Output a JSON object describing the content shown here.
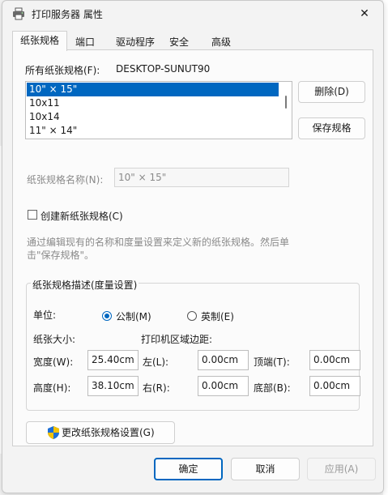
{
  "window": {
    "title": "打印服务器 属性",
    "close_glyph": "✕"
  },
  "tabs": [
    {
      "label": "纸张规格",
      "active": true
    },
    {
      "label": "端口"
    },
    {
      "label": "驱动程序"
    },
    {
      "label": "安全"
    },
    {
      "label": "高级"
    }
  ],
  "forms": {
    "all_forms_label": "所有纸张规格(F):",
    "server_name": "DESKTOP-SUNUT90",
    "list_items": [
      "10\" × 15\"",
      "10x11",
      "10x14",
      "11\" × 14\""
    ],
    "delete_button": "删除(D)",
    "save_button": "保存规格",
    "form_name_label": "纸张规格名称(N):",
    "form_name_value": "10\" × 15\"",
    "create_new_label": "创建新纸张规格(C)",
    "help_text_line1": "通过编辑现有的名称和度量设置来定义新的纸张规格。然后单",
    "help_text_line2": "击\"保存规格\"。",
    "group_title": "纸张规格描述(度量设置)",
    "unit_label": "单位:",
    "metric_label": "公制(M)",
    "english_label": "英制(E)",
    "paper_size_label": "纸张大小:",
    "margins_label": "打印机区域边距:",
    "width_label": "宽度(W):",
    "width_value": "25.40cm",
    "height_label": "高度(H):",
    "height_value": "38.10cm",
    "left_label": "左(L):",
    "left_value": "0.00cm",
    "right_label": "右(R):",
    "right_value": "0.00cm",
    "top_label": "顶端(T):",
    "top_value": "0.00cm",
    "bottom_label": "底部(B):",
    "bottom_value": "0.00cm",
    "change_settings_button": "更改纸张规格设置(G)"
  },
  "footer": {
    "ok": "确定",
    "cancel": "取消",
    "apply": "应用(A)"
  },
  "colors": {
    "accent": "#0067c0",
    "shield_blue": "#1d6fd6",
    "shield_yellow": "#f2c200"
  }
}
